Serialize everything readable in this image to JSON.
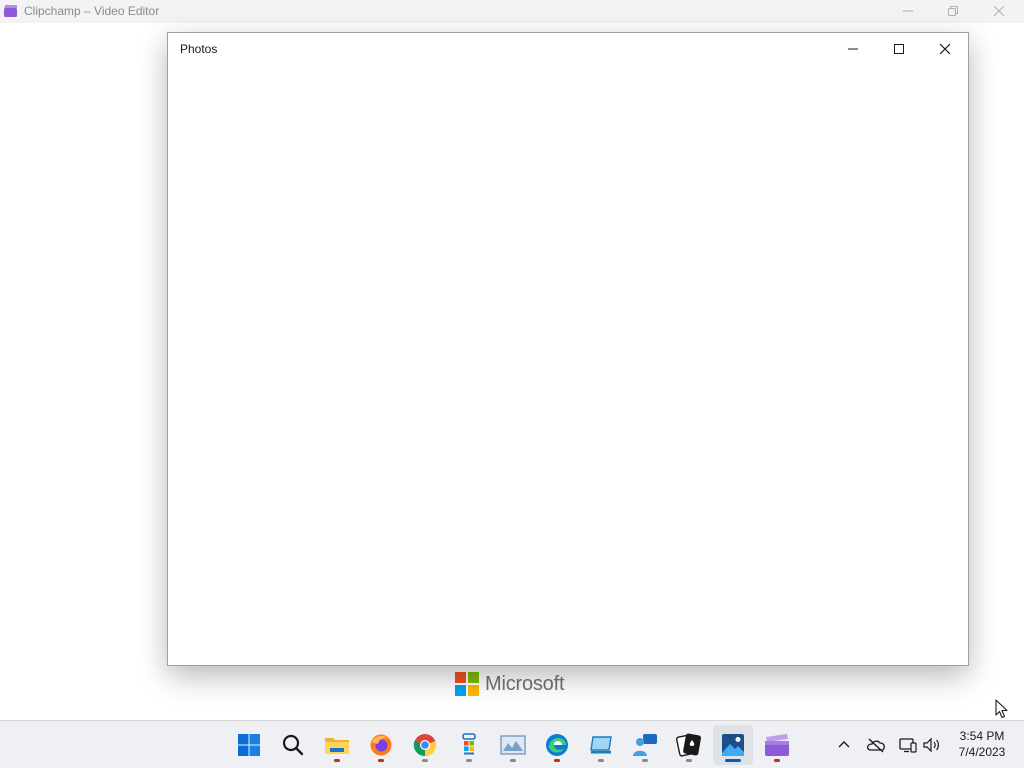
{
  "background_window": {
    "title": "Clipchamp – Video Editor",
    "app_icon": "clipchamp-icon",
    "controls": [
      "minimize-icon",
      "restore-icon",
      "close-icon"
    ]
  },
  "splash": {
    "brand_text": "Microsoft",
    "colors": [
      "#f25022",
      "#7fba00",
      "#00a4ef",
      "#ffb900"
    ]
  },
  "photos_window": {
    "title": "Photos",
    "controls": [
      "minimize-icon",
      "maximize-icon",
      "close-icon"
    ]
  },
  "taskbar": {
    "apps": [
      {
        "name": "start-icon",
        "indicator": "none"
      },
      {
        "name": "search-icon",
        "indicator": "none"
      },
      {
        "name": "file-explorer-icon",
        "indicator": "red"
      },
      {
        "name": "firefox-icon",
        "indicator": "red"
      },
      {
        "name": "chrome-icon",
        "indicator": "gray"
      },
      {
        "name": "microsoft-store-icon",
        "indicator": "gray"
      },
      {
        "name": "photo-viewer-icon",
        "indicator": "gray"
      },
      {
        "name": "edge-icon",
        "indicator": "red"
      },
      {
        "name": "remote-desktop-icon",
        "indicator": "gray"
      },
      {
        "name": "get-help-icon",
        "indicator": "gray"
      },
      {
        "name": "solitaire-icon",
        "indicator": "gray"
      },
      {
        "name": "photos-icon",
        "indicator": "active"
      },
      {
        "name": "clipchamp-icon",
        "indicator": "red"
      }
    ],
    "tray": [
      "chevron-up-icon",
      "onedrive-offline-icon",
      "network-icon",
      "volume-icon"
    ],
    "clock": {
      "time": "3:54 PM",
      "date": "7/4/2023"
    }
  },
  "accent_color": "#005fb8"
}
